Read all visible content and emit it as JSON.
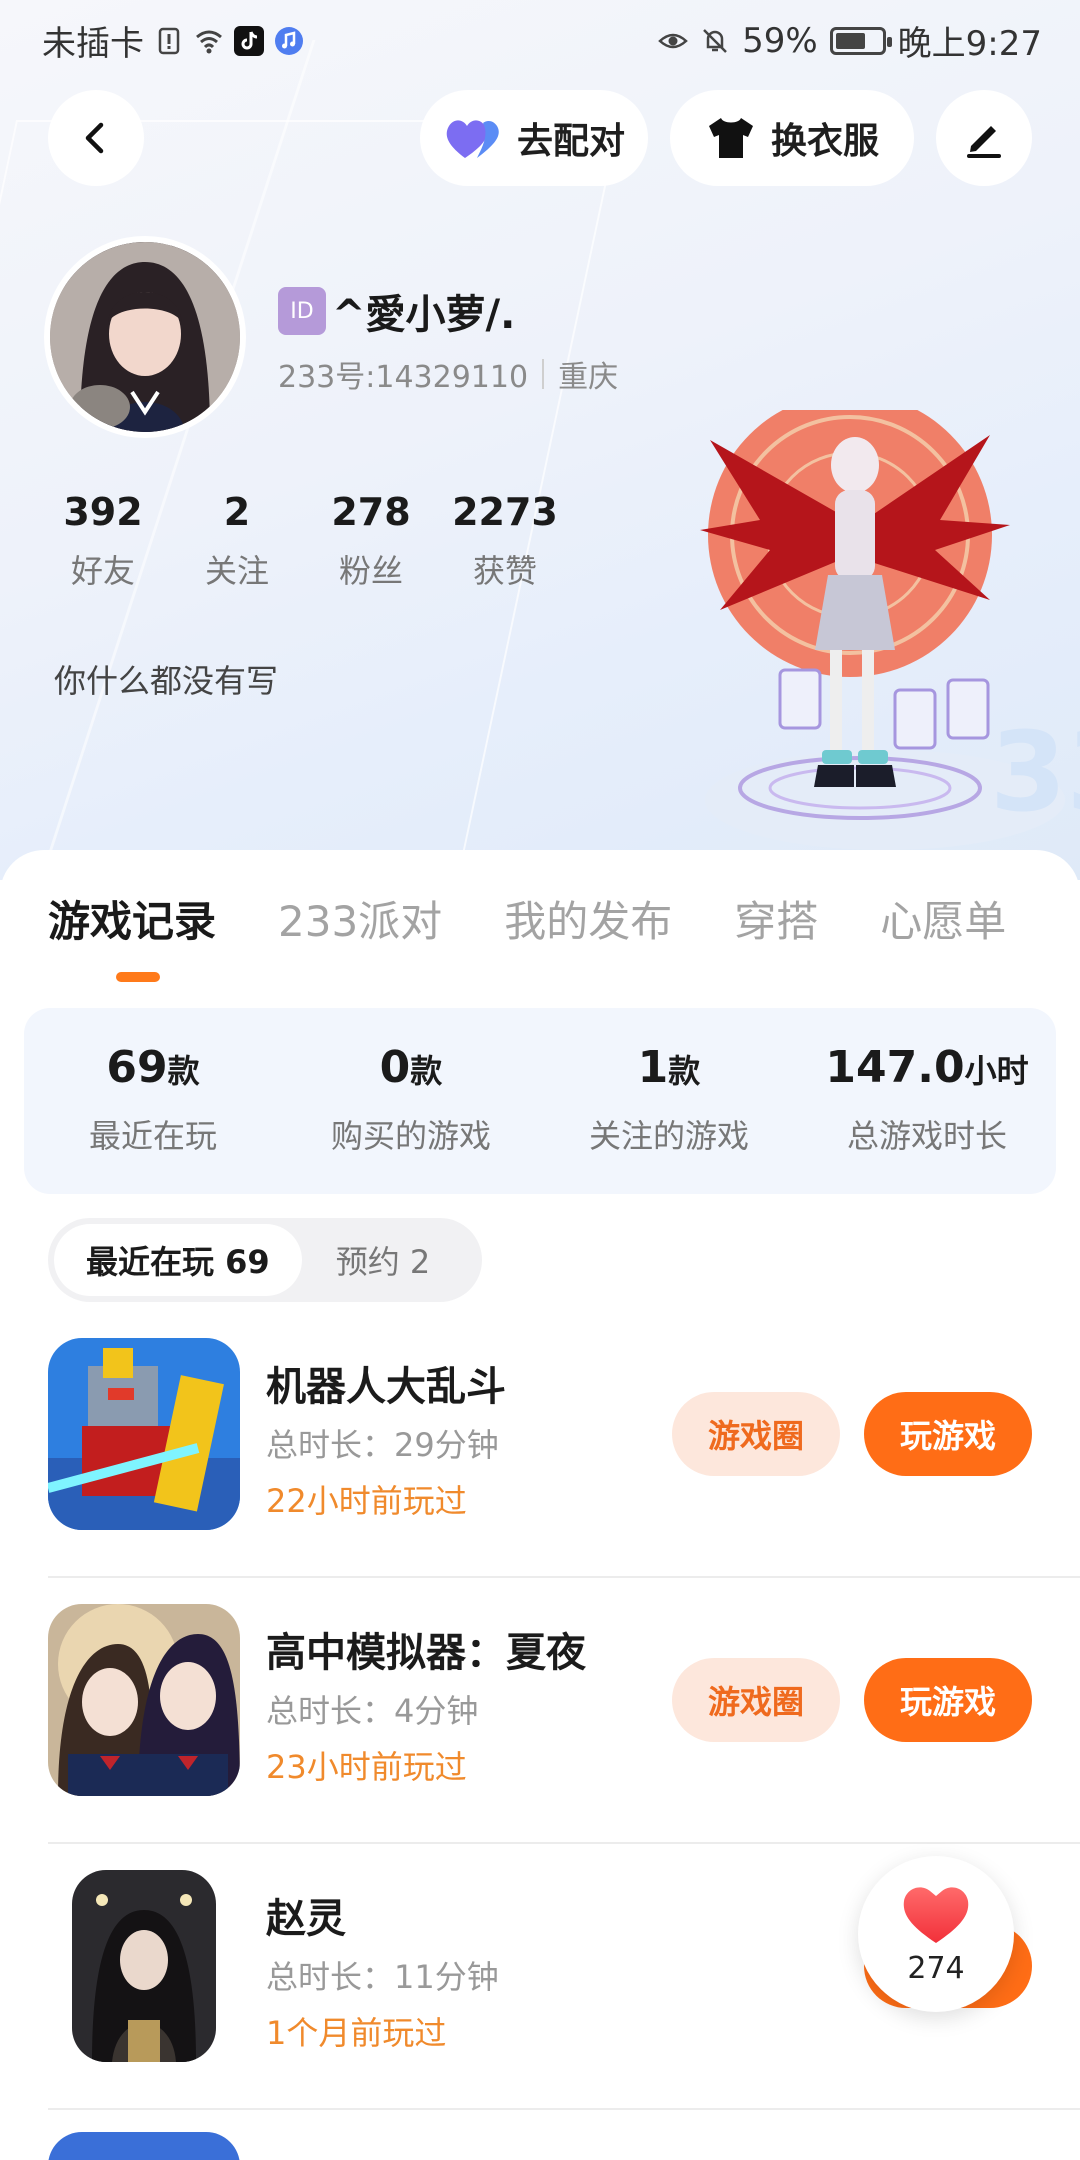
{
  "status_bar": {
    "carrier": "未插卡",
    "battery": "59%",
    "battery_fraction": 0.59,
    "time": "晚上9:27"
  },
  "top_bar": {
    "party_label": "去配对",
    "outfit_label": "换衣服"
  },
  "profile": {
    "id_badge": "ID",
    "name": "^愛小萝/.",
    "user_number": "233号:14329110",
    "location": "重庆",
    "stats": [
      {
        "value": "392",
        "label": "好友"
      },
      {
        "value": "2",
        "label": "关注"
      },
      {
        "value": "278",
        "label": "粉丝"
      },
      {
        "value": "2273",
        "label": "获赞"
      }
    ],
    "bio": "你什么都没有写"
  },
  "tabs": [
    {
      "label": "游戏记录"
    },
    {
      "label": "233派对"
    },
    {
      "label": "我的发布"
    },
    {
      "label": "穿搭"
    },
    {
      "label": "心愿单"
    }
  ],
  "summary": [
    {
      "value": "69",
      "unit": "款",
      "label": "最近在玩"
    },
    {
      "value": "0",
      "unit": "款",
      "label": "购买的游戏"
    },
    {
      "value": "1",
      "unit": "款",
      "label": "关注的游戏"
    },
    {
      "value": "147.0",
      "unit": "小时",
      "label": "总游戏时长"
    }
  ],
  "filter": {
    "recent": "最近在玩 69",
    "reserved": "预约 2"
  },
  "games": [
    {
      "title": "机器人大乱斗",
      "duration": "总时长：29分钟",
      "last_played": "22小时前玩过",
      "circle_label": "游戏圈",
      "play_label": "玩游戏"
    },
    {
      "title": "高中模拟器：夏夜",
      "duration": "总时长：4分钟",
      "last_played": "23小时前玩过",
      "circle_label": "游戏圈",
      "play_label": "玩游戏"
    },
    {
      "title": "赵灵",
      "duration": "总时长：11分钟",
      "last_played": "1个月前玩过",
      "circle_label": "",
      "play_label": ""
    }
  ],
  "like": {
    "count": "274"
  },
  "colors": {
    "accent": "#ff6d16",
    "accent_soft": "#fde7dc",
    "last_played": "#f08a2c",
    "summary_bg": "#f2f6fd"
  }
}
